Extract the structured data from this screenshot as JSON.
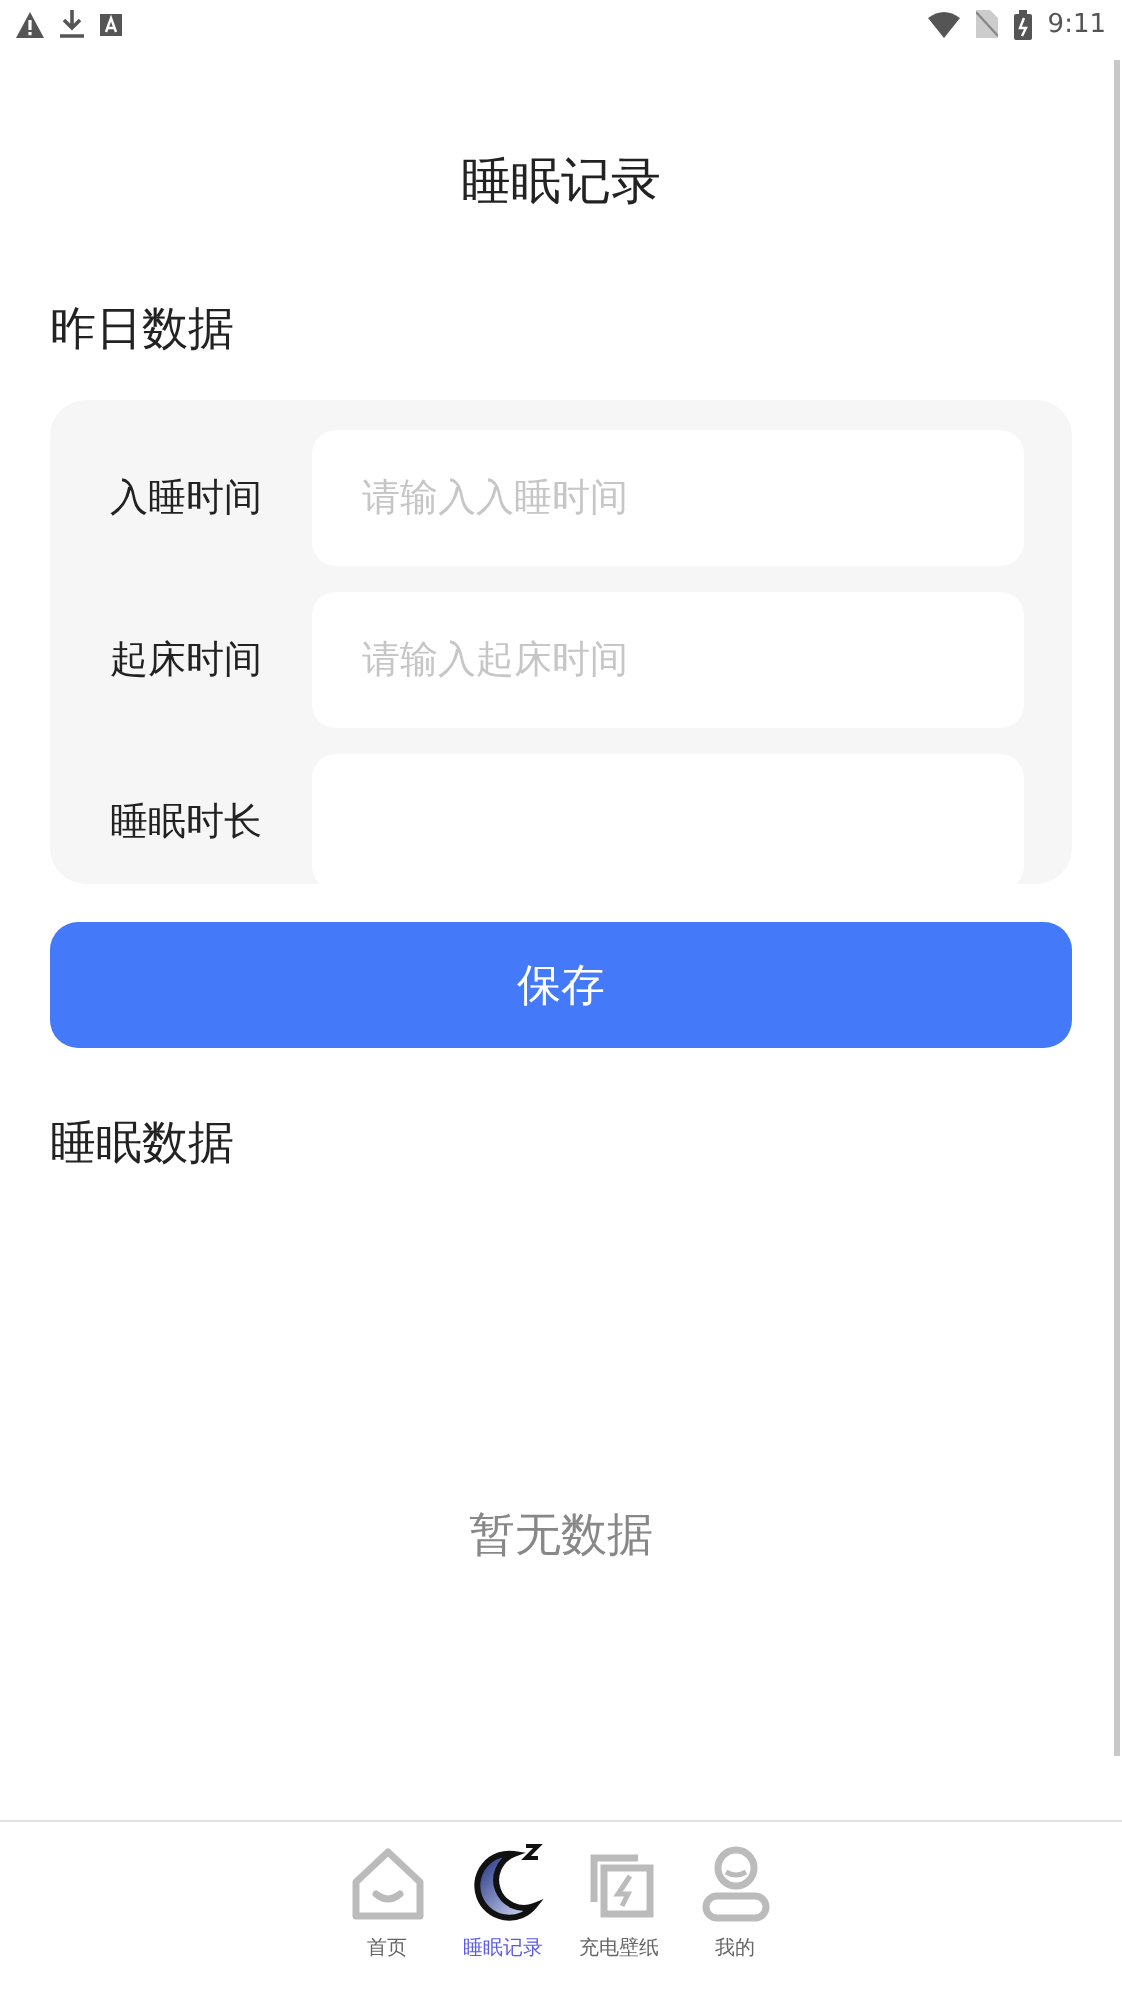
{
  "status_bar": {
    "time": "9:11"
  },
  "title": "睡眠记录",
  "yesterday": {
    "heading": "昨日数据",
    "fields": [
      {
        "label": "入睡时间",
        "placeholder": "请输入入睡时间"
      },
      {
        "label": "起床时间",
        "placeholder": "请输入起床时间"
      },
      {
        "label": "睡眠时长"
      }
    ]
  },
  "save_button": "保存",
  "sleep_data": {
    "heading": "睡眠数据",
    "empty": "暂无数据"
  },
  "tabs": [
    {
      "kind": "home",
      "label": "首页",
      "selected": false
    },
    {
      "kind": "moon",
      "label": "睡眠记录",
      "selected": true
    },
    {
      "kind": "wallpaper",
      "label": "充电壁纸",
      "selected": false
    },
    {
      "kind": "profile",
      "label": "我的",
      "selected": false
    }
  ]
}
